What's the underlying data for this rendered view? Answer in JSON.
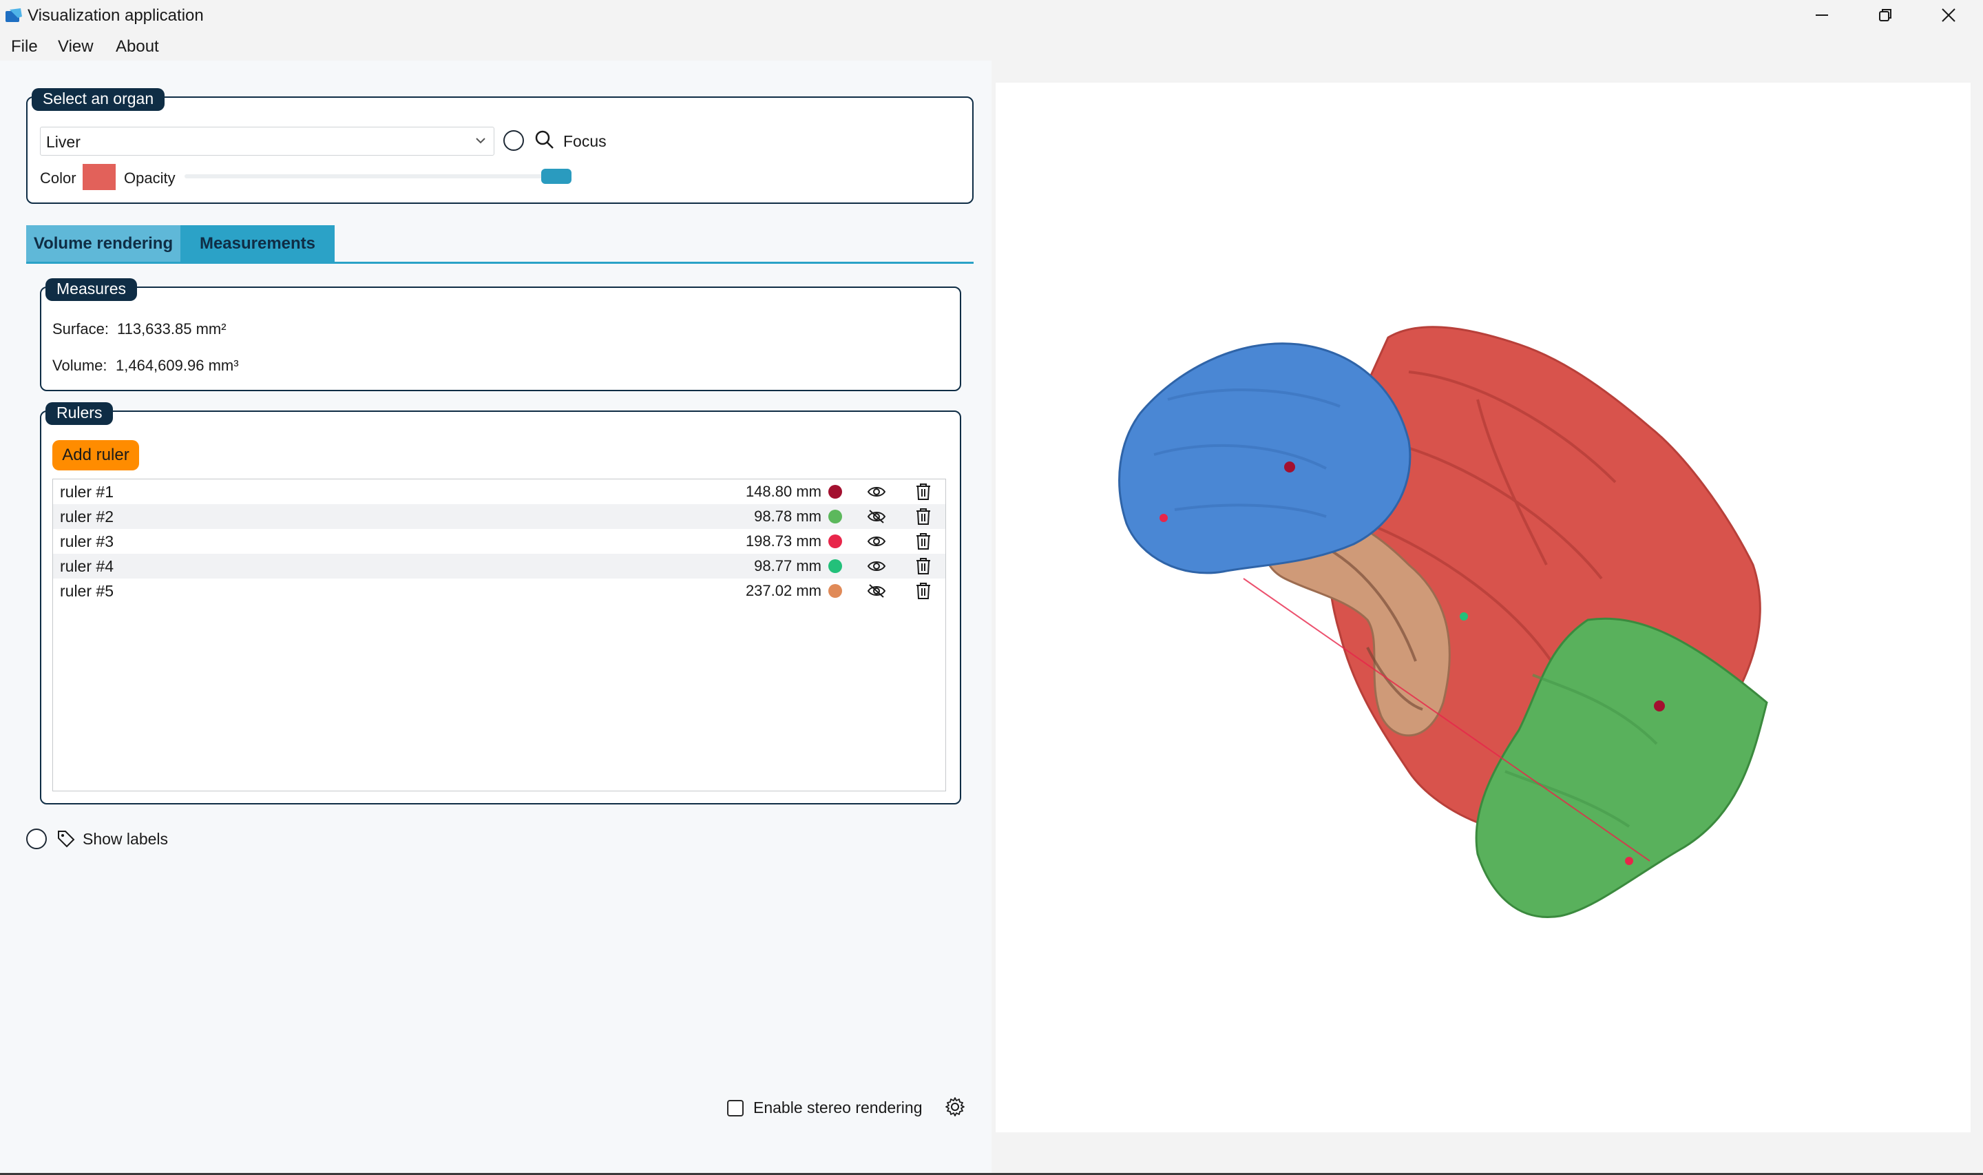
{
  "window": {
    "title": "Visualization application",
    "icon": "app-icon"
  },
  "menu": {
    "file": "File",
    "view": "View",
    "about": "About"
  },
  "organ_group": {
    "title": "Select an organ",
    "selected": "Liver",
    "focus_label": "Focus",
    "color_label": "Color",
    "color_value": "#e2615a",
    "opacity_label": "Opacity",
    "opacity_value": 1.0
  },
  "tabs": {
    "volume_rendering": "Volume rendering",
    "measurements": "Measurements",
    "active": "measurements"
  },
  "measures": {
    "title": "Measures",
    "surface_label": "Surface:",
    "surface_value": "113,633.85 mm²",
    "volume_label": "Volume:",
    "volume_value": "1,464,609.96 mm³"
  },
  "rulers": {
    "title": "Rulers",
    "add_label": "Add ruler",
    "items": [
      {
        "name": "ruler #1",
        "length": "148.80 mm",
        "color": "#a3102f",
        "visible": true
      },
      {
        "name": "ruler #2",
        "length": "98.78 mm",
        "color": "#5cb85c",
        "visible": false
      },
      {
        "name": "ruler #3",
        "length": "198.73 mm",
        "color": "#e8264a",
        "visible": true
      },
      {
        "name": "ruler #4",
        "length": "98.77 mm",
        "color": "#23c07a",
        "visible": true
      },
      {
        "name": "ruler #5",
        "length": "237.02 mm",
        "color": "#e08a58",
        "visible": false
      }
    ]
  },
  "show_labels": "Show labels",
  "stereo": {
    "label": "Enable stereo rendering",
    "checked": false
  },
  "colors": {
    "accent_dark": "#0f2d45",
    "tab_active": "#2ba2c7",
    "tab_inactive": "#5fb8d8",
    "add_button": "#ff8c00",
    "liver": "#d8534c",
    "organ_blue": "#4a87d4",
    "organ_green": "#59b15c",
    "organ_tan": "#cf9a78"
  }
}
